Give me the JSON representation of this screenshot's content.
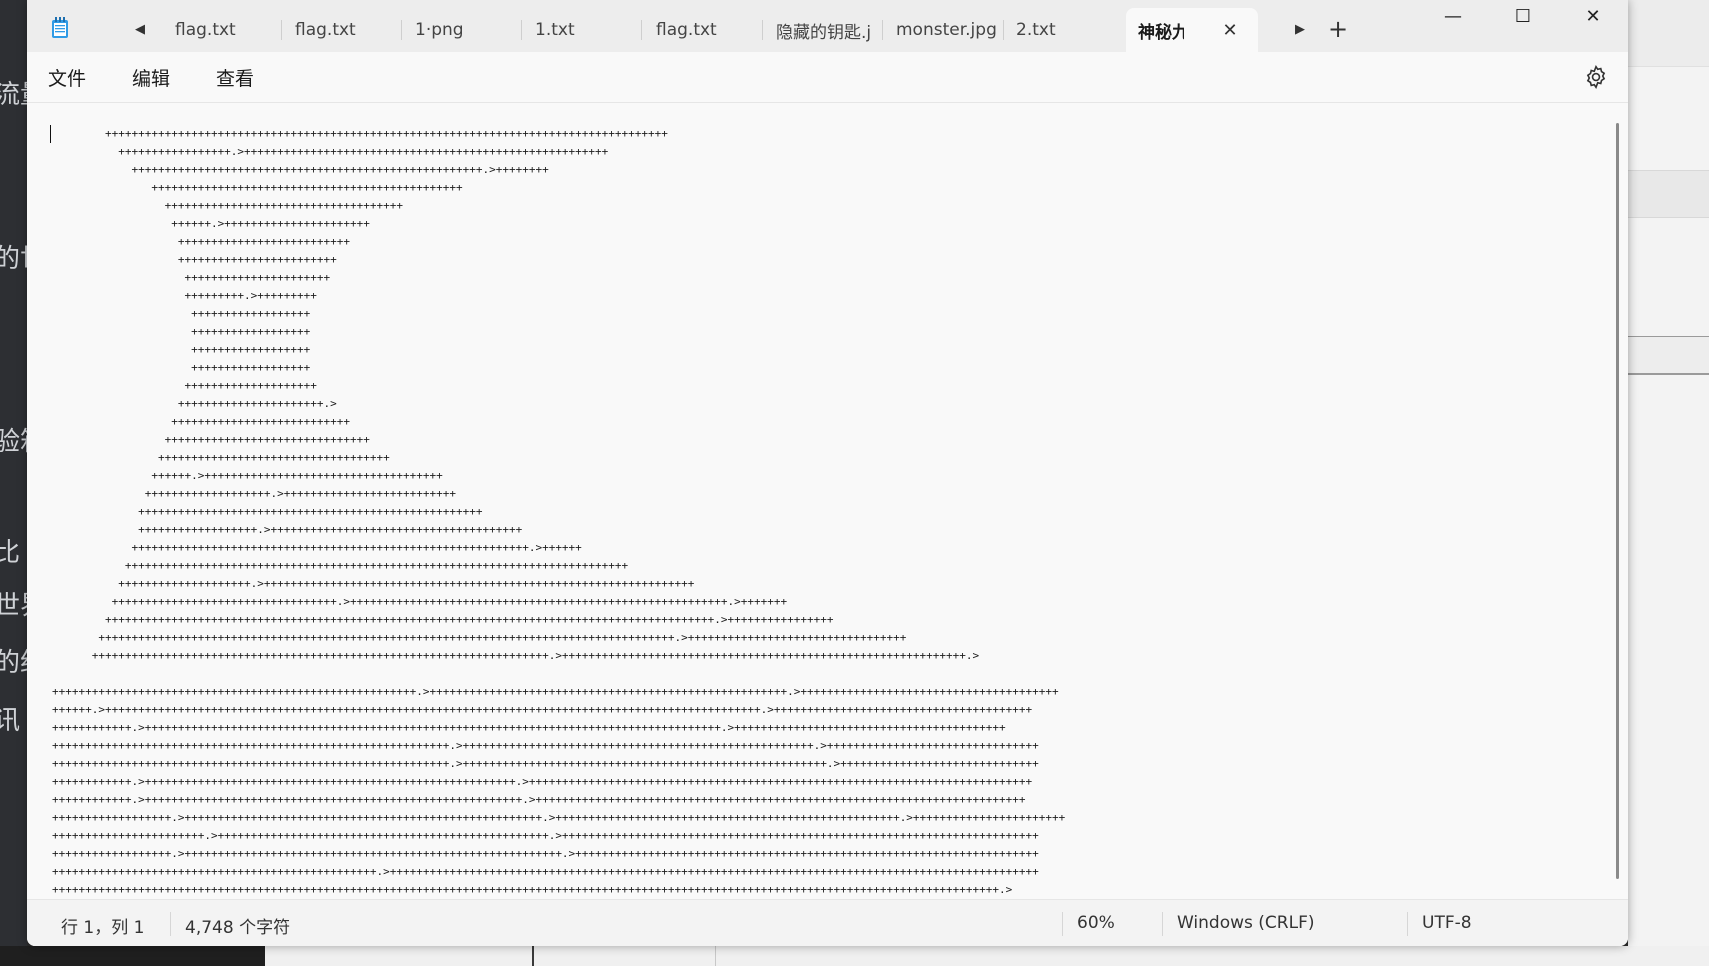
{
  "window": {
    "tabs": [
      {
        "label": "flag.txt"
      },
      {
        "label": "flag.txt"
      },
      {
        "label": "1·png"
      },
      {
        "label": "1.txt"
      },
      {
        "label": "flag.txt"
      },
      {
        "label": "隐藏的钥匙.j"
      },
      {
        "label": "monster.jpg"
      },
      {
        "label": "2.txt"
      }
    ],
    "active_tab": {
      "label": "神秘九"
    },
    "controls": {
      "minimize": "—",
      "maximize": "☐",
      "close": "✕"
    }
  },
  "menu": {
    "file": "文件",
    "edit": "编辑",
    "view": "查看"
  },
  "editor": {
    "lines": [
      "        +++++++++++++++++++++++++++++++++++++++++++++++++++++++++++++++++++++++++++++++++++++",
      "          +++++++++++++++++.>+++++++++++++++++++++++++++++++++++++++++++++++++++++++",
      "            +++++++++++++++++++++++++++++++++++++++++++++++++++++.>++++++++",
      "               +++++++++++++++++++++++++++++++++++++++++++++++",
      "                 ++++++++++++++++++++++++++++++++++++",
      "                  ++++++.>++++++++++++++++++++++",
      "                   ++++++++++++++++++++++++++",
      "                   ++++++++++++++++++++++++",
      "                    ++++++++++++++++++++++",
      "                    +++++++++.>+++++++++",
      "                     ++++++++++++++++++",
      "                     ++++++++++++++++++",
      "                     ++++++++++++++++++",
      "                     ++++++++++++++++++",
      "                    ++++++++++++++++++++",
      "                   ++++++++++++++++++++++.>",
      "                  +++++++++++++++++++++++++++",
      "                 +++++++++++++++++++++++++++++++",
      "                +++++++++++++++++++++++++++++++++++",
      "               ++++++.>++++++++++++++++++++++++++++++++++++",
      "              +++++++++++++++++++.>++++++++++++++++++++++++++",
      "             ++++++++++++++++++++++++++++++++++++++++++++++++++++",
      "             ++++++++++++++++++.>++++++++++++++++++++++++++++++++++++++",
      "            ++++++++++++++++++++++++++++++++++++++++++++++++++++++++++++.>++++++",
      "           ++++++++++++++++++++++++++++++++++++++++++++++++++++++++++++++++++++++++++++",
      "          ++++++++++++++++++++.>+++++++++++++++++++++++++++++++++++++++++++++++++++++++++++++++++",
      "         ++++++++++++++++++++++++++++++++++.>+++++++++++++++++++++++++++++++++++++++++++++++++++++++++.>+++++++",
      "        ++++++++++++++++++++++++++++++++++++++++++++++++++++++++++++++++++++++++++++++++++++++++++++.>++++++++++++++++",
      "       +++++++++++++++++++++++++++++++++++++++++++++++++++++++++++++++++++++++++++++++++++++++.>+++++++++++++++++++++++++++++++++",
      "      +++++++++++++++++++++++++++++++++++++++++++++++++++++++++++++++++++++.>+++++++++++++++++++++++++++++++++++++++++++++++++++++++++++++.>",
      "",
      "+++++++++++++++++++++++++++++++++++++++++++++++++++++++.>++++++++++++++++++++++++++++++++++++++++++++++++++++++.>+++++++++++++++++++++++++++++++++++++++",
      "++++++.>+++++++++++++++++++++++++++++++++++++++++++++++++++++++++++++++++++++++++++++++++++++++++++++++++++.>+++++++++++++++++++++++++++++++++++++++",
      "++++++++++++.>+++++++++++++++++++++++++++++++++++++++++++++++++++++++++++++++++++++++++++++++++++++++.>+++++++++++++++++++++++++++++++++++++++++",
      "++++++++++++++++++++++++++++++++++++++++++++++++++++++++++++.>+++++++++++++++++++++++++++++++++++++++++++++++++++++.>++++++++++++++++++++++++++++++++",
      "++++++++++++++++++++++++++++++++++++++++++++++++++++++++++++.>+++++++++++++++++++++++++++++++++++++++++++++++++++++++.>++++++++++++++++++++++++++++++",
      "++++++++++++.>++++++++++++++++++++++++++++++++++++++++++++++++++++++++.>++++++++++++++++++++++++++++++++++++++++++++++++++++++++++++++++++++++++++++",
      "++++++++++++.>+++++++++++++++++++++++++++++++++++++++++++++++++++++++++.>++++++++++++++++++++++++++++++++++++++++++++++++++++++++++++++++++++++++++",
      "++++++++++++++++++.>++++++++++++++++++++++++++++++++++++++++++++++++++++++.>++++++++++++++++++++++++++++++++++++++++++++++++++++.>+++++++++++++++++++++++",
      "+++++++++++++++++++++++.>++++++++++++++++++++++++++++++++++++++++++++++++++.>++++++++++++++++++++++++++++++++++++++++++++++++++++++++++++++++++++++++",
      "++++++++++++++++++.>+++++++++++++++++++++++++++++++++++++++++++++++++++++++++.>++++++++++++++++++++++++++++++++++++++++++++++++++++++++++++++++++++++",
      "+++++++++++++++++++++++++++++++++++++++++++++++++.>++++++++++++++++++++++++++++++++++++++++++++++++++++++++++++++++++++++++++++++++++++++++++++++++++",
      "+++++++++++++++++++++++++++++++++++++++++++++++++++++++++++++++++++++++++++++++++++++++++++++++++++++++++++++++++++++++++++++++++++++++++++++++.>"
    ]
  },
  "status": {
    "position": "行 1，列 1",
    "char_count": "4,748 个字符",
    "zoom": "60%",
    "line_ending": "Windows (CRLF)",
    "encoding": "UTF-8"
  },
  "background_fragments": [
    "流量",
    "的世",
    "验箱",
    "比",
    "世界",
    "的约",
    "讯"
  ]
}
